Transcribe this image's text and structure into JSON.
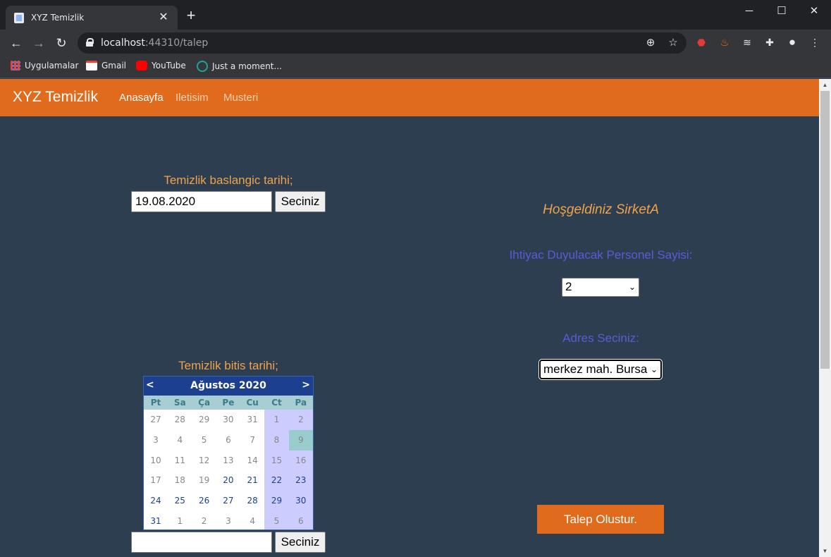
{
  "browser": {
    "tab_title": "XYZ Temizlik",
    "tab_close": "✕",
    "new_tab": "+",
    "url_host": "localhost",
    "url_rest": ":44310/talep",
    "bookmarks": [
      {
        "label": "Uygulamalar",
        "icon": "apps-grid-icon",
        "color": "#e8453c"
      },
      {
        "label": "Gmail",
        "icon": "gmail-icon",
        "color": "#ea4335"
      },
      {
        "label": "YouTube",
        "icon": "youtube-icon",
        "color": "#ff0000"
      },
      {
        "label": "Just a moment...",
        "icon": "globe-icon",
        "color": "#1aa59a"
      }
    ]
  },
  "navbar": {
    "brand": "XYZ Temizlik",
    "links": [
      {
        "label": "Anasayfa",
        "active": true
      },
      {
        "label": "Iletisim",
        "active": false
      },
      {
        "label": "Musteri",
        "active": false
      }
    ],
    "color": "#e06b1c"
  },
  "form": {
    "start_label": "Temizlik baslangic tarihi;",
    "start_value": "19.08.2020",
    "start_button": "Seciniz",
    "end_label": "Temizlik bitis tarihi;",
    "end_value": "",
    "end_button": "Seciniz",
    "welcome": "Hoşgeldiniz SirketA",
    "staff_label": "Ihtiyac Duyulacak Personel Sayisi:",
    "staff_value": "2",
    "address_label": "Adres Seciniz:",
    "address_value": "merkez mah. Bursa",
    "submit": "Talep Olustur."
  },
  "calendar": {
    "prev": "<",
    "next": ">",
    "title": "Ağustos 2020",
    "weekdays": [
      "Pt",
      "Sa",
      "Ça",
      "Pe",
      "Cu",
      "Ct",
      "Pa"
    ],
    "weeks": [
      [
        "27",
        "28",
        "29",
        "30",
        "31",
        "1",
        "2"
      ],
      [
        "3",
        "4",
        "5",
        "6",
        "7",
        "8",
        "9"
      ],
      [
        "10",
        "11",
        "12",
        "13",
        "14",
        "15",
        "16"
      ],
      [
        "17",
        "18",
        "19",
        "20",
        "21",
        "22",
        "23"
      ],
      [
        "24",
        "25",
        "26",
        "27",
        "28",
        "29",
        "30"
      ],
      [
        "31",
        "1",
        "2",
        "3",
        "4",
        "5",
        "6"
      ]
    ],
    "selectable_from": {
      "week": 3,
      "day": 3
    },
    "today": {
      "week": 1,
      "day": 6
    },
    "colors": {
      "header": "#1c3f8f",
      "weekend": "#ccccff",
      "today": "#99cccc",
      "active_text": "#1c3f8f",
      "disabled_text": "#888888"
    }
  }
}
